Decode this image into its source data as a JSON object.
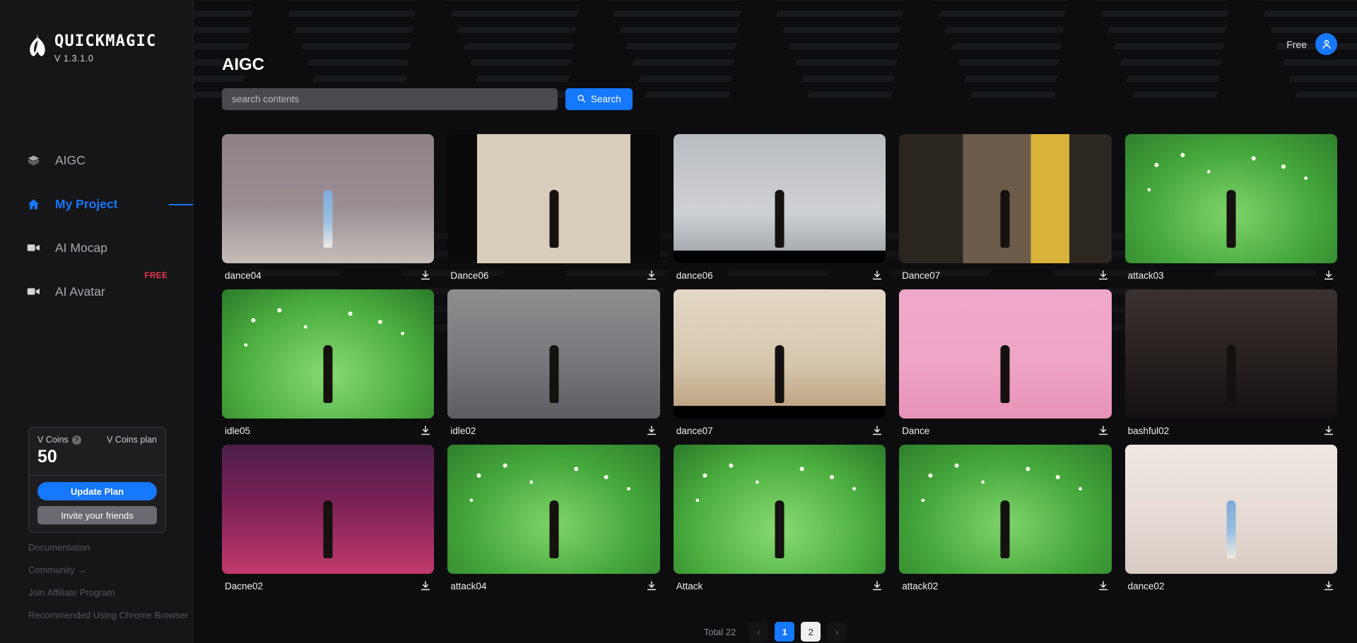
{
  "brand": {
    "name": "QUICKMAGIC",
    "version": "V 1.3.1.0",
    "logo_icon": "quickmagic-logo-icon"
  },
  "sidebar": {
    "items": [
      {
        "label": "AIGC",
        "icon": "layers-icon",
        "active": false,
        "badge": ""
      },
      {
        "label": "My Project",
        "icon": "home-icon",
        "active": true,
        "badge": ""
      },
      {
        "label": "AI Mocap",
        "icon": "video-camera-icon",
        "active": false,
        "badge": ""
      },
      {
        "label": "AI Avatar",
        "icon": "video-camera-icon",
        "active": false,
        "badge": "FREE"
      }
    ],
    "coins": {
      "label": "V Coins",
      "help_icon": "question-mark-icon",
      "plan_label": "V Coins plan",
      "value": "50",
      "update_button": "Update Plan",
      "invite_button": "Invite your friends"
    },
    "footer_links": [
      "Documentation",
      "Community →",
      "Join Affiliate Program",
      "Recommended Using Chrome Browser"
    ]
  },
  "topbar": {
    "plan": "Free",
    "avatar_icon": "user-avatar-icon"
  },
  "page": {
    "title": "AIGC"
  },
  "search": {
    "placeholder": "search contents",
    "value": "",
    "button_label": "Search",
    "button_icon": "search-icon"
  },
  "grid": {
    "download_icon": "download-icon",
    "cards": [
      {
        "name": "dance04",
        "scene": "s-room",
        "fig": "fig-blue",
        "extra": ""
      },
      {
        "name": "Dance06",
        "scene": "s-curtain",
        "fig": "fig-dark",
        "extra": ""
      },
      {
        "name": "dance06",
        "scene": "s-office",
        "fig": "fig-dark",
        "extra": "letterbox"
      },
      {
        "name": "Dance07",
        "scene": "s-street",
        "fig": "fig-dark",
        "extra": ""
      },
      {
        "name": "attack03",
        "scene": "s-green",
        "fig": "fig-dark",
        "extra": "lights"
      },
      {
        "name": "idle05",
        "scene": "s-green2",
        "fig": "fig-dark",
        "extra": "lights"
      },
      {
        "name": "idle02",
        "scene": "s-grey",
        "fig": "fig-dark",
        "extra": ""
      },
      {
        "name": "dance07",
        "scene": "s-wood",
        "fig": "fig-dark",
        "extra": "letterbox"
      },
      {
        "name": "Dance",
        "scene": "s-pink",
        "fig": "fig-dark",
        "extra": ""
      },
      {
        "name": "bashful02",
        "scene": "s-black",
        "fig": "fig-dark",
        "extra": ""
      },
      {
        "name": "Dacne02",
        "scene": "s-neon",
        "fig": "fig-dark",
        "extra": ""
      },
      {
        "name": "attack04",
        "scene": "s-green",
        "fig": "fig-dark",
        "extra": "lights"
      },
      {
        "name": "Attack",
        "scene": "s-green2",
        "fig": "fig-dark",
        "extra": "lights"
      },
      {
        "name": "attack02",
        "scene": "s-green",
        "fig": "fig-dark",
        "extra": "lights"
      },
      {
        "name": "dance02",
        "scene": "s-white",
        "fig": "fig-blue",
        "extra": ""
      }
    ]
  },
  "pagination": {
    "total_label": "Total 22",
    "prev_icon": "chevron-left-icon",
    "next_icon": "chevron-right-icon",
    "pages": [
      "1",
      "2"
    ],
    "current": "1"
  },
  "colors": {
    "accent": "#1677ff",
    "badge_free": "#e8384f",
    "bg": "#0d0d0f",
    "sidebar_bg": "#161618"
  }
}
